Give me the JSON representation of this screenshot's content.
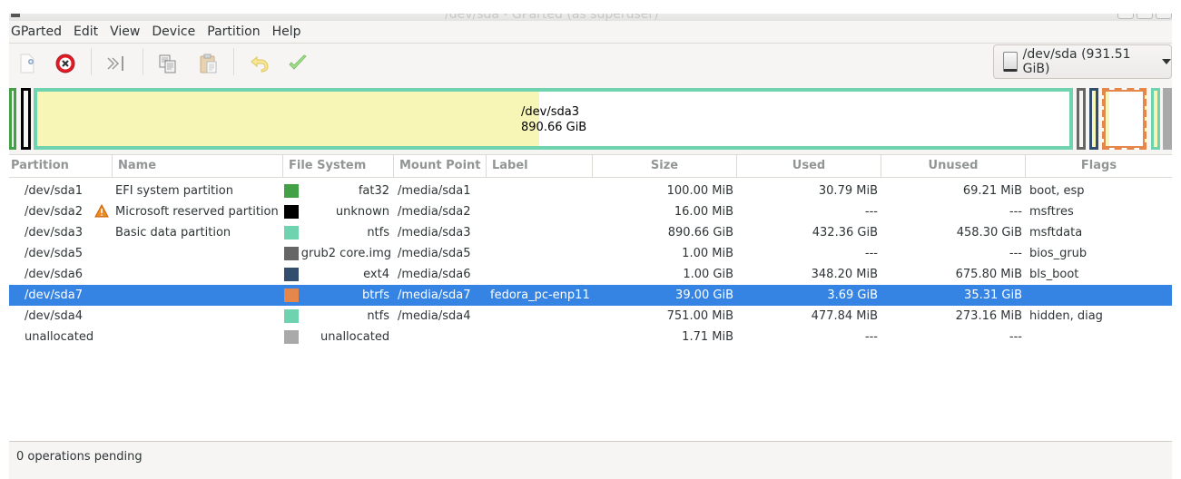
{
  "window": {
    "title": "/dev/sda - GParted (as superuser)"
  },
  "menubar": {
    "items": [
      "GParted",
      "Edit",
      "View",
      "Device",
      "Partition",
      "Help"
    ]
  },
  "toolbar": {
    "buttons": [
      {
        "name": "new-partition",
        "icon": "new-document-icon",
        "enabled": false
      },
      {
        "name": "delete-partition",
        "icon": "delete-icon",
        "enabled": true
      },
      {
        "name": "resize-move",
        "icon": "resize-move-icon",
        "enabled": false
      },
      {
        "name": "copy",
        "icon": "copy-icon",
        "enabled": false
      },
      {
        "name": "paste",
        "icon": "paste-icon",
        "enabled": false
      },
      {
        "name": "undo",
        "icon": "undo-icon",
        "enabled": false
      },
      {
        "name": "apply",
        "icon": "apply-checkmark-icon",
        "enabled": false
      }
    ],
    "device_selector": {
      "value": "/dev/sda (931.51 GiB)",
      "icon": "hard-disk-icon"
    }
  },
  "disk_map": {
    "selected_label": "/dev/sda3",
    "selected_size": "890.66 GiB",
    "segments": [
      {
        "partition": "/dev/sda1",
        "color": "#43a047",
        "used_fraction": 0.31
      },
      {
        "partition": "/dev/sda2",
        "color": "#000000",
        "used_fraction": 0
      },
      {
        "partition": "/dev/sda3",
        "color": "#70d3b0",
        "used_fraction": 0.485
      },
      {
        "partition": "/dev/sda5",
        "color": "#666666",
        "used_fraction": 0
      },
      {
        "partition": "/dev/sda6",
        "color": "#324e6c",
        "used_fraction": 0.34
      },
      {
        "partition": "/dev/sda7",
        "color": "#e5864a",
        "used_fraction": 0.095,
        "selected": true
      },
      {
        "partition": "/dev/sda4",
        "color": "#70d3b0",
        "used_fraction": 0.64
      },
      {
        "partition": "unallocated",
        "color": "#a9a9a9",
        "used_fraction": 0
      }
    ]
  },
  "table": {
    "columns": [
      "Partition",
      "Name",
      "File System",
      "Mount Point",
      "Label",
      "Size",
      "Used",
      "Unused",
      "Flags"
    ],
    "rows": [
      {
        "partition": "/dev/sda1",
        "name": "EFI system partition",
        "fs_color": "#43a047",
        "filesystem": "fat32",
        "mount": "/media/sda1",
        "label": "",
        "size": "100.00 MiB",
        "used": "30.79 MiB",
        "unused": "69.21 MiB",
        "flags": "boot, esp",
        "warning": false,
        "selected": false
      },
      {
        "partition": "/dev/sda2",
        "name": "Microsoft reserved partition",
        "fs_color": "#000000",
        "filesystem": "unknown",
        "mount": "/media/sda2",
        "label": "",
        "size": "16.00 MiB",
        "used": "---",
        "unused": "---",
        "flags": "msftres",
        "warning": true,
        "selected": false
      },
      {
        "partition": "/dev/sda3",
        "name": "Basic data partition",
        "fs_color": "#70d3b0",
        "filesystem": "ntfs",
        "mount": "/media/sda3",
        "label": "",
        "size": "890.66 GiB",
        "used": "432.36 GiB",
        "unused": "458.30 GiB",
        "flags": "msftdata",
        "warning": false,
        "selected": false
      },
      {
        "partition": "/dev/sda5",
        "name": "",
        "fs_color": "#666666",
        "filesystem": "grub2 core.img",
        "mount": "/media/sda5",
        "label": "",
        "size": "1.00 MiB",
        "used": "---",
        "unused": "---",
        "flags": "bios_grub",
        "warning": false,
        "selected": false
      },
      {
        "partition": "/dev/sda6",
        "name": "",
        "fs_color": "#324e6c",
        "filesystem": "ext4",
        "mount": "/media/sda6",
        "label": "",
        "size": "1.00 GiB",
        "used": "348.20 MiB",
        "unused": "675.80 MiB",
        "flags": "bls_boot",
        "warning": false,
        "selected": false
      },
      {
        "partition": "/dev/sda7",
        "name": "",
        "fs_color": "#e5864a",
        "filesystem": "btrfs",
        "mount": "/media/sda7",
        "label": "fedora_pc-enp11",
        "size": "39.00 GiB",
        "used": "3.69 GiB",
        "unused": "35.31 GiB",
        "flags": "",
        "warning": false,
        "selected": true
      },
      {
        "partition": "/dev/sda4",
        "name": "",
        "fs_color": "#70d3b0",
        "filesystem": "ntfs",
        "mount": "/media/sda4",
        "label": "",
        "size": "751.00 MiB",
        "used": "477.84 MiB",
        "unused": "273.16 MiB",
        "flags": "hidden, diag",
        "warning": false,
        "selected": false
      },
      {
        "partition": "unallocated",
        "name": "",
        "fs_color": "#a9a9a9",
        "filesystem": "unallocated",
        "mount": "",
        "label": "",
        "size": "1.71 MiB",
        "used": "---",
        "unused": "---",
        "flags": "",
        "warning": false,
        "selected": false
      }
    ]
  },
  "statusbar": {
    "text": "0 operations pending"
  },
  "colors": {
    "selection": "#3584e4",
    "used_space": "#f7f6b7"
  }
}
